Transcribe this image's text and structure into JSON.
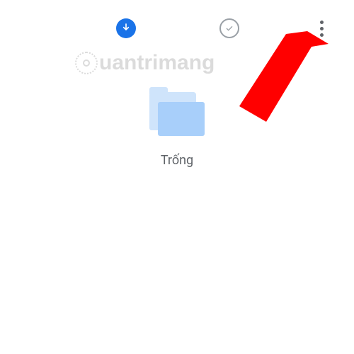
{
  "toolbar": {
    "download_icon": "download-icon",
    "check_icon": "check-icon",
    "more_icon": "more-vertical-icon"
  },
  "watermark": {
    "text": "uantrimang"
  },
  "folder": {
    "label": "Trống",
    "icon": "folder-icon"
  },
  "annotation": {
    "arrow_color": "#ff0000",
    "description": "red-arrow-pointing-to-more-button"
  }
}
